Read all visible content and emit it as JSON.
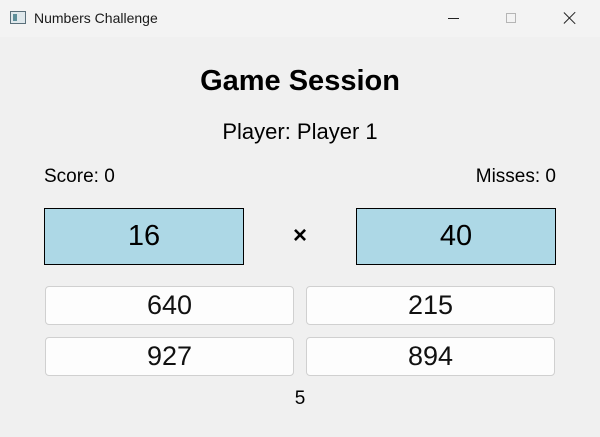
{
  "window": {
    "title": "Numbers Challenge"
  },
  "game": {
    "heading": "Game Session",
    "player_label": "Player: Player 1",
    "score_label": "Score: 0",
    "misses_label": "Misses: 0",
    "factor_a": "16",
    "operator": "×",
    "factor_b": "40",
    "answers": [
      "640",
      "215",
      "927",
      "894"
    ],
    "timer": "5"
  },
  "colors": {
    "factor_box_bg": "#add8e6",
    "window_bg": "#f0f0f0"
  }
}
